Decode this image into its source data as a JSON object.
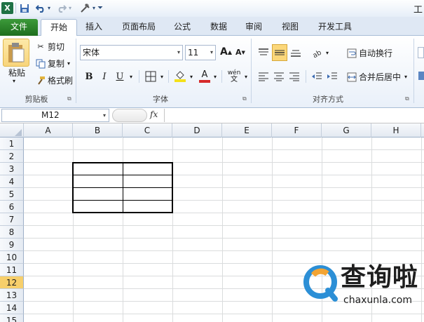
{
  "app": {
    "window_title": "工"
  },
  "quick_access": {
    "icons": [
      "excel-logo-icon",
      "save-icon",
      "undo-icon",
      "redo-icon",
      "tools-icon",
      "customize-icon"
    ]
  },
  "tabs": [
    "文件",
    "开始",
    "插入",
    "页面布局",
    "公式",
    "数据",
    "审阅",
    "视图",
    "开发工具"
  ],
  "active_tab": "开始",
  "ribbon": {
    "clipboard": {
      "paste": "粘贴",
      "cut": "剪切",
      "copy": "复制",
      "format_painter": "格式刷",
      "group_label": "剪贴板"
    },
    "font": {
      "font_name": "宋体",
      "font_size": "11",
      "bold": "B",
      "italic": "I",
      "underline": "U",
      "fill_letter": "A",
      "font_color_letter": "A",
      "phonetic": "wén",
      "group_label": "字体"
    },
    "alignment": {
      "wrap_text": "自动换行",
      "merge_center": "合并后居中",
      "group_label": "对齐方式"
    },
    "colors": {
      "fill_underline": "#f4e11a",
      "font_color_underline": "#d62b2b",
      "accent": "#217346"
    }
  },
  "formula_bar": {
    "name_box": "M12",
    "fx": "fx",
    "formula": ""
  },
  "sheet": {
    "columns": [
      "A",
      "B",
      "C",
      "D",
      "E",
      "F",
      "G",
      "H"
    ],
    "rows": [
      "1",
      "2",
      "3",
      "4",
      "5",
      "6",
      "7",
      "8",
      "9",
      "10",
      "11",
      "12",
      "13",
      "14",
      "15"
    ],
    "selected_row": "12",
    "bordered_range": "B3:C6"
  },
  "watermark": {
    "brand": "查询啦",
    "domain": "chaxunla.com"
  }
}
